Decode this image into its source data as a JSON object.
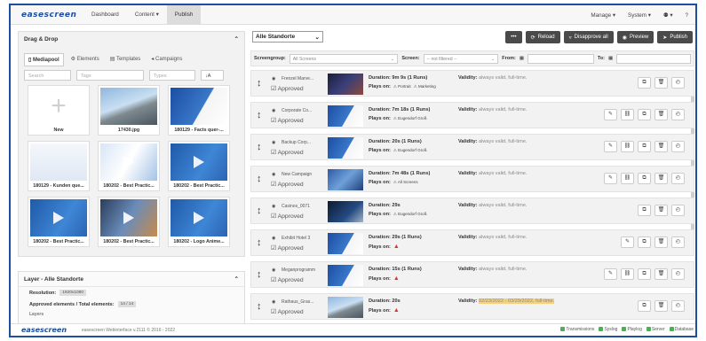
{
  "nav": {
    "logo": "easescreen",
    "items": [
      "Dashboard",
      "Content ▾",
      "Publish"
    ],
    "right": [
      "Manage ▾",
      "System ▾",
      "⚉ ▾",
      "?"
    ]
  },
  "dragdrop": {
    "title": "Drag & Drop",
    "tabs": [
      "Mediapool",
      "Elements",
      "Templates",
      "Campaigns"
    ],
    "filters": {
      "search": "Search",
      "tags": "Tags",
      "types": "Types",
      "sort": "↓A"
    },
    "tiles": [
      {
        "label": "New",
        "kind": "new"
      },
      {
        "label": "17430.jpg",
        "kind": "building"
      },
      {
        "label": "180129 - Facts quer-...",
        "kind": "blue"
      },
      {
        "label": "180129 - Kunden que...",
        "kind": "white"
      },
      {
        "label": "180202 - Best Practic...",
        "kind": "play-light"
      },
      {
        "label": "180202 - Best Practic...",
        "kind": "play-blue"
      },
      {
        "label": "180202 - Best Practic...",
        "kind": "play-blue"
      },
      {
        "label": "180202 - Best Practic...",
        "kind": "play-dark"
      },
      {
        "label": "180202 - Logo Anime...",
        "kind": "play-blue"
      }
    ]
  },
  "layer": {
    "title": "Layer - Alle Standorte",
    "resolution_label": "Resolution:",
    "resolution": "1920x1080",
    "approved_label": "Approved elements / Total elements:",
    "approved": "14 / 14",
    "next": "Layers"
  },
  "main": {
    "location": "Alle Standorte",
    "buttons": [
      "•••",
      "Reload",
      "Disapprove all",
      "Preview",
      "Publish"
    ],
    "filters": {
      "screengroup_label": "Screengroup:",
      "screengroup": "All Screens",
      "screen_label": "Screen:",
      "screen": "-- not filtered --",
      "from_label": "From:",
      "to_label": "To:"
    },
    "approved_text": "Approved",
    "duration_label": "Duration:",
    "plays_label": "Plays on:",
    "validity_label": "Validity:",
    "rows": [
      {
        "name": "Frenzel Marve...",
        "duration": "9m 9s (1 Runs)",
        "tags": [
          "Portrait",
          "Marketing"
        ],
        "validity": "always valid, full-time.",
        "thumb": "dark",
        "actions": 3
      },
      {
        "name": "Corporate Co...",
        "duration": "7m 18s (1 Runs)",
        "tags": [
          "Eugendorf Groß"
        ],
        "validity": "always valid, full-time.",
        "thumb": "blue",
        "actions": 5
      },
      {
        "name": "Backup Corp...",
        "duration": "20s (1 Runs)",
        "tags": [
          "Eugendorf Groß"
        ],
        "validity": "always valid, full-time.",
        "thumb": "blue",
        "actions": 5
      },
      {
        "name": "New Campaign",
        "duration": "7m 48s (1 Runs)",
        "tags": [
          "All Screens"
        ],
        "validity": "always valid, full-time.",
        "thumb": "blue2",
        "actions": 5
      },
      {
        "name": "Casinos_0071",
        "duration": "29s",
        "tags": [
          "Eugendorf Groß"
        ],
        "validity": "always valid, full-time.",
        "thumb": "dark2",
        "actions": 3
      },
      {
        "name": "Exhibit Hotel 3",
        "duration": "29s (1 Runs)",
        "tags": [],
        "warn": true,
        "validity": "always valid, full-time.",
        "thumb": "blue",
        "actions": 4
      },
      {
        "name": "Meganprogramm",
        "duration": "15s (1 Runs)",
        "tags": [],
        "warn": true,
        "validity": "always valid, full-time.",
        "thumb": "blue",
        "actions": 5
      },
      {
        "name": "Rathaus_Gras...",
        "duration": "20s",
        "tags": [],
        "warn": true,
        "validity": "02/23/2022 - 03/29/2022, full-time.",
        "highlight": true,
        "thumb": "building",
        "actions": 3
      }
    ]
  },
  "footer": {
    "logo": "easescreen",
    "version": "easescreen Webinterface v.2111 © 2016 - 2022",
    "status": [
      "Transmissions",
      "Syslog",
      "Playlog",
      "Server",
      "Database"
    ]
  },
  "colors": {
    "brand": "#1d4fa0",
    "dark_button": "#4a4a4a",
    "highlight": "#f5d17a",
    "warn": "#dd3333"
  }
}
